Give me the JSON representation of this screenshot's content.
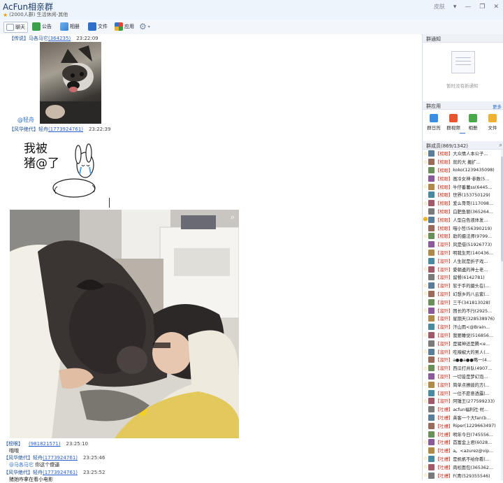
{
  "window": {
    "title": "AcFun相亲群",
    "subtitle": "(2000人群) 生活休闲-其他",
    "skin_label": "皮肤",
    "controls": [
      "▾",
      "—",
      "❐",
      "✕"
    ]
  },
  "toolbar": {
    "chat": "聊天",
    "notice": "公告",
    "album": "相册",
    "files": "文件",
    "apps": "应用"
  },
  "messages": [
    {
      "rank": "【传说】",
      "name": "马各马它",
      "qq": "(364235)",
      "time": "23:22:09"
    },
    {
      "mention": "@轻舟"
    },
    {
      "rank": "【风华绝代】",
      "name": "轻舟",
      "qq": "(1773924761)",
      "time": "23:22:39"
    },
    {
      "sticker_text": "我被\n猪@了"
    },
    {
      "rank": "【榜眼】",
      "name": "",
      "qq": "(981821571)",
      "time": "23:25:10",
      "text": "哦哦"
    },
    {
      "rank": "【风华绝代】",
      "name": "轻舟",
      "qq": "(1773924761)",
      "time": "23:25:46",
      "mention": "@马各马它",
      "text": " 你这个傻逼"
    },
    {
      "rank": "【风华绝代】",
      "name": "轻舟",
      "qq": "(1773924761)",
      "time": "23:25:52",
      "text": "猪她咋拿在看小电影"
    }
  ],
  "notice_panel": {
    "title": "群通知",
    "empty_text": "暂时没有新通知"
  },
  "apps_panel": {
    "title": "群应用",
    "more": "更多",
    "items": [
      {
        "label": "群日历",
        "icon": "calendar-icon",
        "color": "#3a8de0"
      },
      {
        "label": "群视频",
        "icon": "video-icon",
        "color": "#e8552f"
      },
      {
        "label": "相册",
        "icon": "photo-icon",
        "color": "#4aa84a"
      },
      {
        "label": "文件",
        "icon": "folder-icon",
        "color": "#f0b030"
      }
    ]
  },
  "members_panel": {
    "title": "群成员(869/1342)",
    "members": [
      {
        "rank": "【榜眼】",
        "name": "大众情人本公子...",
        "badge": "☆"
      },
      {
        "rank": "【榜眼】",
        "name": "就的大     搬扩...",
        "badge": "☆"
      },
      {
        "rank": "【榜眼】",
        "name": "koko(1239435098)",
        "badge": ""
      },
      {
        "rank": "【榜眼】",
        "name": "画冷女神·参数(5...",
        "badge": ""
      },
      {
        "rank": "【榜眼】",
        "name": "牛仔番薯ss(6445...",
        "badge": "☆"
      },
      {
        "rank": "【榜眼】",
        "name": "世界(153750129)",
        "badge": ""
      },
      {
        "rank": "【榜眼】",
        "name": "爱么哥哥(117098...",
        "badge": "☆"
      },
      {
        "rank": "【榜眼】",
        "name": "白肥鱼丽(365264...",
        "badge": ""
      },
      {
        "rank": "【榜眼】",
        "name": "人型白色液体发...",
        "badge": "☻"
      },
      {
        "rank": "【榜眼】",
        "name": "喵小哲(56390219)",
        "badge": ""
      },
      {
        "rank": "【榜眼】",
        "name": "助的摄法师(9799...",
        "badge": "☆"
      },
      {
        "rank": "【溜歼】",
        "name": "风是借(51926773)",
        "badge": ""
      },
      {
        "rank": "【溜歼】",
        "name": "明我生死(140436...",
        "badge": ""
      },
      {
        "rank": "【溜歼】",
        "name": "人生就是折子戏...",
        "badge": ""
      },
      {
        "rank": "【溜歼】",
        "name": "愛朝邊的神士老...",
        "badge": "☆"
      },
      {
        "rank": "【溜歼】",
        "name": "留餐(6142781)",
        "badge": ""
      },
      {
        "rank": "【溜歼】",
        "name": "软于手的摄头在(...",
        "badge": "☆"
      },
      {
        "rank": "【溜歼】",
        "name": "幻想乡的八云紫(...",
        "badge": "☆"
      },
      {
        "rank": "【溜歼】",
        "name": "三千(341813028)",
        "badge": ""
      },
      {
        "rank": "【溜歼】",
        "name": "困长的不行(2925...",
        "badge": "☆"
      },
      {
        "rank": "【溜歼】",
        "name": "星期天(328538976)",
        "badge": ""
      },
      {
        "rank": "【溜歼】",
        "name": "汗山雨<@Brain...",
        "badge": ""
      },
      {
        "rank": "【溜歼】",
        "name": "我要睡觉(516856...",
        "badge": "☆"
      },
      {
        "rank": "【溜歼】",
        "name": "是猪神还是腾<e...",
        "badge": ""
      },
      {
        "rank": "【溜歼】",
        "name": "吃辣椒大的男人(...",
        "badge": "☆"
      },
      {
        "rank": "【溜歼】",
        "name": "a●●a●●略一(4...",
        "badge": ""
      },
      {
        "rank": "【溜歼】",
        "name": "西瓜打井队(4907...",
        "badge": "☆"
      },
      {
        "rank": "【溜歼】",
        "name": "一切皆是梦幻泡...",
        "badge": ""
      },
      {
        "rank": "【溜歼】",
        "name": "简单点撩拨的方(...",
        "badge": "☆"
      },
      {
        "rank": "【溜歼】",
        "name": "一位不愿意透露(...",
        "badge": ""
      },
      {
        "rank": "【溜歼】",
        "name": "阿锤王(277599233)",
        "badge": "☆"
      },
      {
        "rank": "【吐槽】",
        "name": "acfun福利社·村...",
        "badge": ""
      },
      {
        "rank": "【吐槽】",
        "name": "英客一个大fan(b...",
        "badge": ""
      },
      {
        "rank": "【吐槽】",
        "name": "Riper(1229663497)",
        "badge": ""
      },
      {
        "rank": "【吐槽】",
        "name": "明年今日(745556...",
        "badge": ""
      },
      {
        "rank": "【吐槽】",
        "name": "首富金上君(6028...",
        "badge": "☆"
      },
      {
        "rank": "【吐槽】",
        "name": "a。<azurez@vip...",
        "badge": ""
      },
      {
        "rank": "【吐槽】",
        "name": "是帆帆不给你看(...",
        "badge": "☆"
      },
      {
        "rank": "【吐槽】",
        "name": "肉松面包(365362...",
        "badge": "☆"
      },
      {
        "rank": "【吐槽】",
        "name": "F(青(529355546)",
        "badge": "☆"
      }
    ]
  }
}
